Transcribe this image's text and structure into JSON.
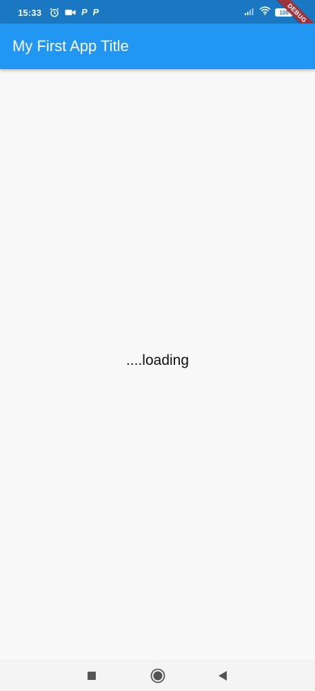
{
  "status_bar": {
    "time": "15:33",
    "left_icons": [
      "alarm-icon",
      "video-camera-icon",
      "p-app-icon",
      "p-app-icon"
    ],
    "p_label": "P",
    "battery_level": "100",
    "right_icons": [
      "signal-icon",
      "wifi-icon",
      "battery-icon"
    ]
  },
  "debug_banner": {
    "label": "DEBUG"
  },
  "app_bar": {
    "title": "My First App Title",
    "color": "#2196f3"
  },
  "body": {
    "loading_text": "....loading"
  },
  "nav_bar": {
    "buttons": [
      "recent-apps-button",
      "home-button",
      "back-button"
    ]
  },
  "colors": {
    "status_bar": "#1a78c2",
    "background": "#f7f8f7",
    "debug_ribbon": "#a0323c"
  }
}
